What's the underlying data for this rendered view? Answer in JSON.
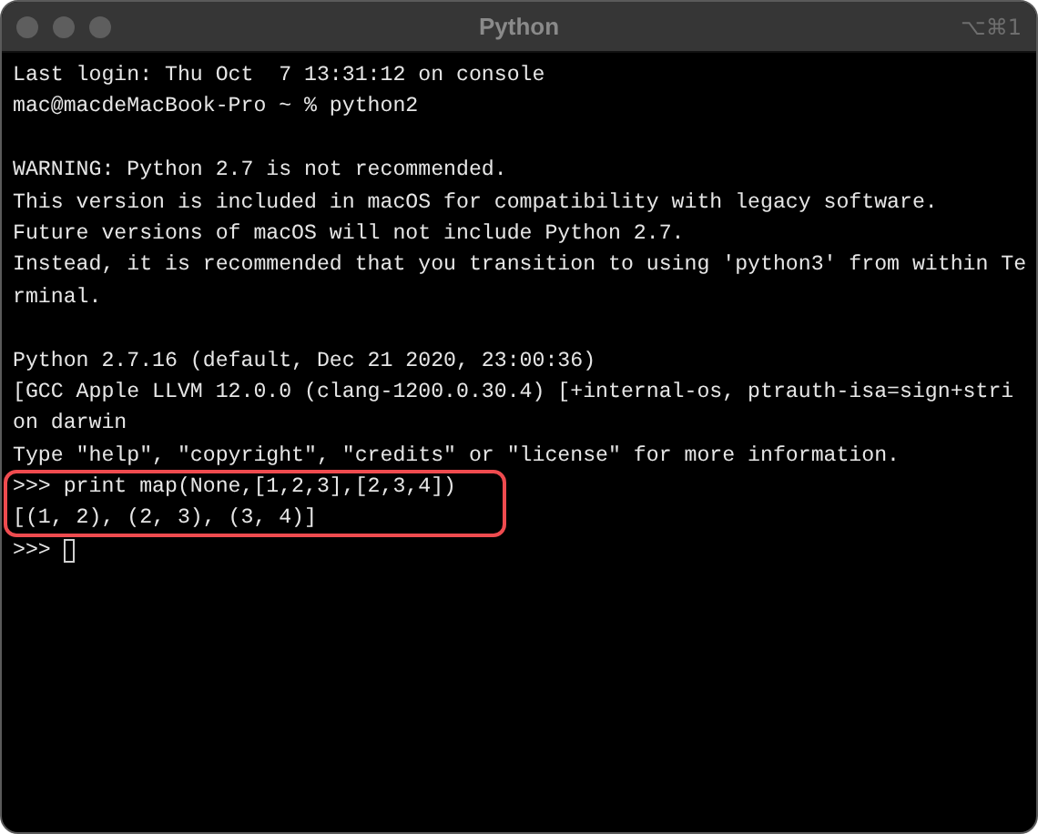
{
  "window": {
    "title": "Python",
    "shortcut": "⌥⌘1"
  },
  "terminal": {
    "lines": [
      {
        "kind": "text",
        "text": "Last login: Thu Oct  7 13:31:12 on console"
      },
      {
        "kind": "text",
        "text": "mac@macdeMacBook-Pro ~ % python2"
      },
      {
        "kind": "blank"
      },
      {
        "kind": "text",
        "text": "WARNING: Python 2.7 is not recommended."
      },
      {
        "kind": "text",
        "text": "This version is included in macOS for compatibility with legacy software."
      },
      {
        "kind": "text",
        "text": "Future versions of macOS will not include Python 2.7."
      },
      {
        "kind": "text",
        "text": "Instead, it is recommended that you transition to using 'python3' from within Te"
      },
      {
        "kind": "text",
        "text": "rminal."
      },
      {
        "kind": "blank"
      },
      {
        "kind": "text",
        "text": "Python 2.7.16 (default, Dec 21 2020, 23:00:36)"
      },
      {
        "kind": "text",
        "text": "[GCC Apple LLVM 12.0.0 (clang-1200.0.30.4) [+internal-os, ptrauth-isa=sign+stri"
      },
      {
        "kind": "text",
        "text": "on darwin"
      },
      {
        "kind": "text",
        "text": "Type \"help\", \"copyright\", \"credits\" or \"license\" for more information."
      },
      {
        "kind": "text",
        "text": ">>> print map(None,[1,2,3],[2,3,4])",
        "highlighted": true
      },
      {
        "kind": "text",
        "text": "[(1, 2), (2, 3), (3, 4)]",
        "highlighted": true
      },
      {
        "kind": "text",
        "text": ">>> ",
        "cursor": true
      }
    ]
  }
}
